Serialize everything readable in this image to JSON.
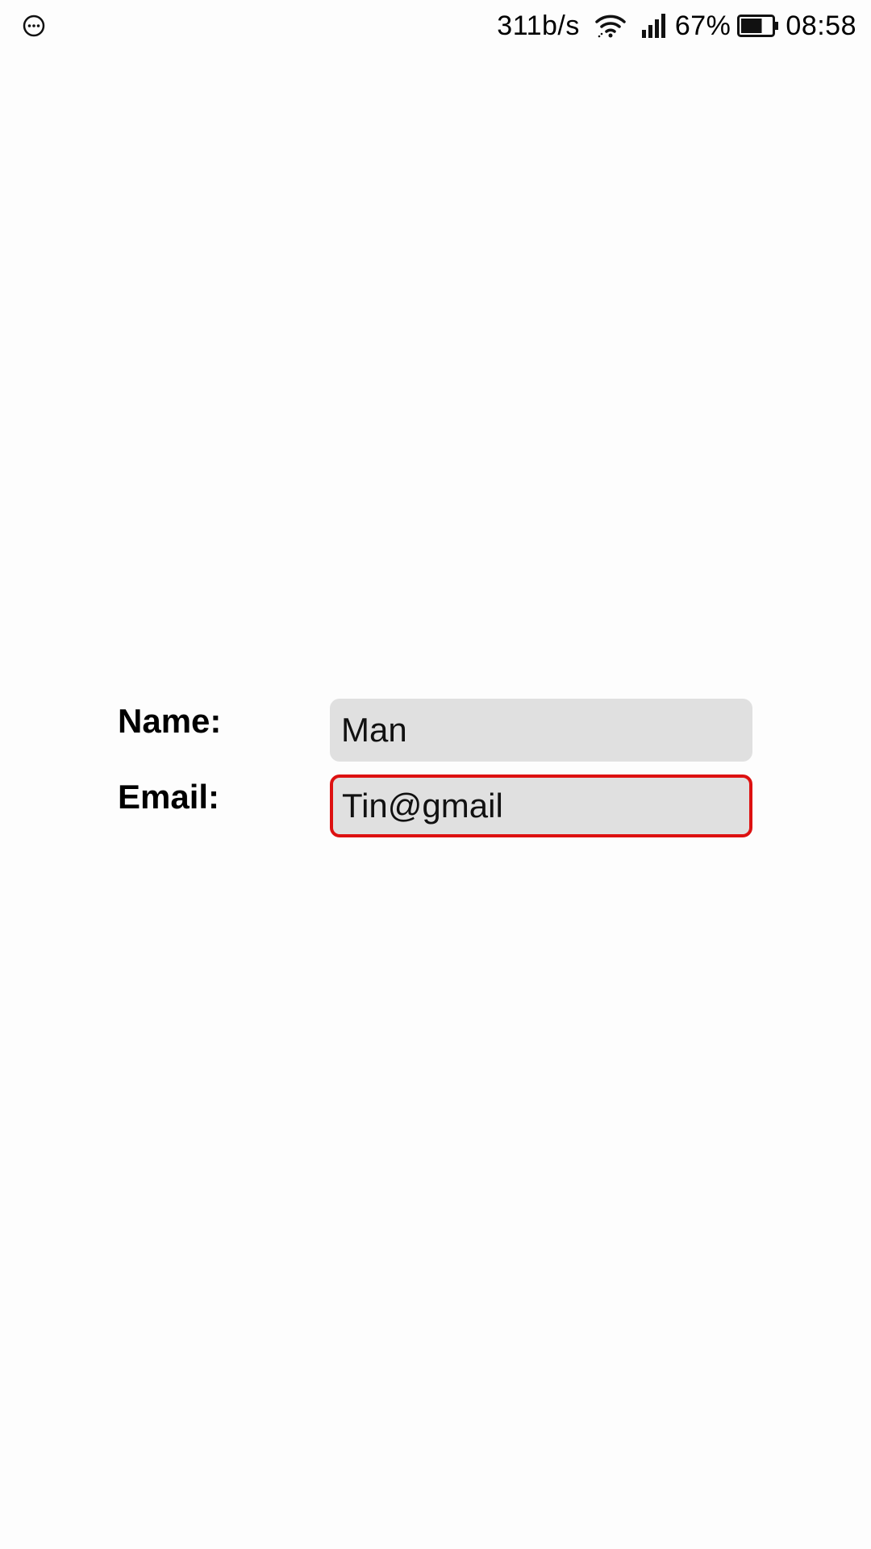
{
  "status_bar": {
    "notification_icon": "chat-bubble-icon",
    "net_speed": "311b/s",
    "wifi_icon": "wifi-icon",
    "signal_icon": "signal-icon",
    "battery_percent": "67%",
    "battery_icon": "battery-icon",
    "battery_level": 0.67,
    "time": "08:58"
  },
  "form": {
    "name_label": "Name:",
    "name_value": "Man",
    "email_label": "Email:",
    "email_value": "Tin@gmail",
    "email_state": "invalid",
    "error_color": "#dd1111",
    "field_background": "#e0e0e0"
  }
}
